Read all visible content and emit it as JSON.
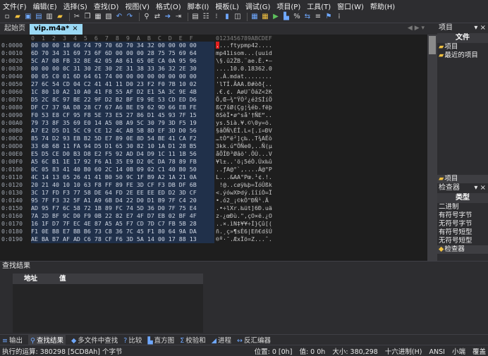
{
  "menu": [
    "文件(F)",
    "编辑(E)",
    "选择(S)",
    "查找(D)",
    "视图(V)",
    "格式(O)",
    "脚本(I)",
    "模板(L)",
    "调试(G)",
    "项目(P)",
    "工具(T)",
    "窗口(W)",
    "帮助(H)"
  ],
  "tabs": [
    {
      "label": "起始页",
      "active": false
    },
    {
      "label": "vip.m4a*",
      "active": true,
      "close": "×"
    }
  ],
  "hex_header": {
    "columns": "0  1  2  3  4  5  6  7  8  9  A  B  C  D  E  F",
    "ascii": "0123456789ABCDEF"
  },
  "rows": [
    {
      "addr": "0:0000",
      "hex": "00 00 00 18 66 74 79 70 6D 70 34 32 00 00 00 00",
      "ascii": "....ftypmp42...."
    },
    {
      "addr": "0:0010",
      "hex": "6D 70 34 31 69 73 6F 6D 00 00 00 28 75 75 69 64",
      "ascii": "mp41isom...(uuid"
    },
    {
      "addr": "0:0020",
      "hex": "5C A7 08 FB 32 8E 42 05 A8 61 65 0E CA 0A 95 96",
      "ascii": "\\§.û2ŽB.¨ae.Ê.•–"
    },
    {
      "addr": "0:0030",
      "hex": "00 00 00 0C 31 30 2E 30 2E 31 38 33 36 32 2E 30",
      "ascii": "....10.0.18362.0"
    },
    {
      "addr": "0:0040",
      "hex": "00 05 C0 01 6D 64 61 74 00 00 00 00 00 00 00 00",
      "ascii": "..À.mdat........"
    },
    {
      "addr": "0:0050",
      "hex": "27 6C 54 CD 04 C2 41 41 11 D0 23 F2 F0 7B 10 02",
      "ascii": "'lTÍ.ÂAA.Ð#òð{.."
    },
    {
      "addr": "0:0060",
      "hex": "1C 80 10 A2 10 A0 41 F8 55 AF D2 E1 5A 3C 9E 4B",
      "ascii": ".€.¢. AøU¯ÒáZ<žK"
    },
    {
      "addr": "0:0070",
      "hex": "D5 2C 8C 97 BE 22 9F D2 B2 BF E9 9E 53 CD ED D6",
      "ascii": "Õ,Œ—¾\"ŸÒ²¿éžSÍíÖ"
    },
    {
      "addr": "0:0080",
      "hex": "DF C7 37 9A D8 28 C7 67 A6 BE E9 62 9D 66 EB FE",
      "ascii": "ßÇ7šØ(Çg¦¾éb.fëþ"
    },
    {
      "addr": "0:0090",
      "hex": "F0 53 E8 CF 95 F8 5E 73 E5 27 86 D1 45 93 7F 15",
      "ascii": "ðSèÏ•ø^så'†ÑE“.."
    },
    {
      "addr": "0:00A0",
      "hex": "79 73 8F 35 69 E0 14 A5 0B A9 5C 30 79 3D F5 19",
      "ascii": "ys.5ià.¥.©\\0y=õ."
    },
    {
      "addr": "0:00B0",
      "hex": "A7 E2 D5 D1 5C C9 CE 12 4C AB 5B 8D EF 3D D0 56",
      "ascii": "§âÕÑ\\ÉÎ.L«[.ï=ÐV"
    },
    {
      "addr": "0:00C0",
      "hex": "85 74 D2 93 EB B2 5D E7 89 0E 8D 54 BE 41 CA F2",
      "ascii": "…tÒ“ë²]ç‰..T¾AÊò"
    },
    {
      "addr": "0:00D0",
      "hex": "33 6B 6B 11 FA 94 D5 D1 65 30 82 10 1A D1 28 B5",
      "ascii": "3kk.ú”ÕÑe0‚..Ñ(µ"
    },
    {
      "addr": "0:00E0",
      "hex": "E5 D5 CE D0 B3 D8 E2 F5 92 AD D4 D9 1C 11 1B 56",
      "ascii": "åÕÎÐ³Øâõ'.ÔÙ...V"
    },
    {
      "addr": "0:00F0",
      "hex": "A5 6C B1 1E 17 92 F6 A1 35 E9 D2 0C DA 78 89 FB",
      "ascii": "¥l±..'ö¡5éÒ.Úx‰û"
    },
    {
      "addr": "0:0100",
      "hex": "0C 05 83 41 40 B0 60 2C 14 0B 09 02 C1 40 B0 50",
      "ascii": "..ƒA@°`,....Á@°P"
    },
    {
      "addr": "0:0110",
      "hex": "4C 14 13 05 26 41 41 B0 50 9C 1F B9 A2 1A 21 0A",
      "ascii": "L...&AA°Pœ.¹¢.!."
    },
    {
      "addr": "0:0120",
      "hex": "20 21 40 10 10 63 F8 FF 89 FE 3D CF F3 DB DF 6B",
      "ascii": " !@..cøÿ‰þ=ÏóÛßk"
    },
    {
      "addr": "0:0130",
      "hex": "3C 17 FD F3 77 58 DE 64 FD 2E EE EE ED D2 3D CF",
      "ascii": "<.ýówXÞdý.îîíÒ=Ï"
    },
    {
      "addr": "0:0140",
      "hex": "95 7F F3 32 5F A1 A9 6B D4 22 D0 D1 B9 7F C4 20",
      "ascii": "•.ó2_¡©kÔ\"ÐÑ¹.Ä "
    },
    {
      "addr": "0:0150",
      "hex": "AD 95 F7 6C 58 72 1B 89 FC 74 5D 36 D0 7F 75 E4",
      "ascii": ".•÷lXr.‰üt]6Ð.uä"
    },
    {
      "addr": "0:0160",
      "hex": "7A 2D BF 9C D0 F9 0B 22 82 E7 4F D7 EB 02 BF 4F",
      "ascii": "z-¿œÐù.\"‚çO×ë.¿O"
    },
    {
      "addr": "0:0170",
      "hex": "16 1F D7 7F EC 4E 87 A5 A5 F7 CD 7D C7 FB 5B 28",
      "ascii": "..×.ìN‡¥¥÷Í}Çû[("
    },
    {
      "addr": "0:0180",
      "hex": "F1 0E B8 E7 BB B6 73 C8 36 7C 45 F1 80 64 9A DA",
      "ascii": "ñ.¸ç»¶sÈ6|Eñ€dšÚ"
    },
    {
      "addr": "0:0190",
      "hex": "AE BA B7 AF AD C6 78 CF F6 3D 5A 14 00 17 88 13",
      "ascii": "®º·¯.ÆxÏö=Z...ˆ."
    }
  ],
  "right_panel": {
    "project_header": "项目",
    "file_title": "文件",
    "project_items": [
      "项目",
      "最近的项目"
    ],
    "mini_tabs": [
      "项目"
    ],
    "inspector_header": "检查器",
    "type_title": "类型",
    "types": [
      "二进制",
      "有符号字节",
      "无符号字节",
      "有符号短型",
      "无符号短型"
    ],
    "inspector_tab": "检查器"
  },
  "find_pane": {
    "title": "查找结果",
    "columns": [
      "地址",
      "值"
    ]
  },
  "bottom_tabs": [
    "输出",
    "查找结果",
    "多文件中查找",
    "比较",
    "直方图",
    "校验和",
    "进程",
    "反汇编器"
  ],
  "status": {
    "left": "执行的运算: 380298 [5CD8Ah] 个字节",
    "position": "位置: 0 [0h]",
    "value": "值: 0 0h",
    "size": "大小: 380,298",
    "mode": "十六进制(H)",
    "encoding": "ANSI",
    "endian": "小端",
    "overwrite": "覆盖"
  }
}
